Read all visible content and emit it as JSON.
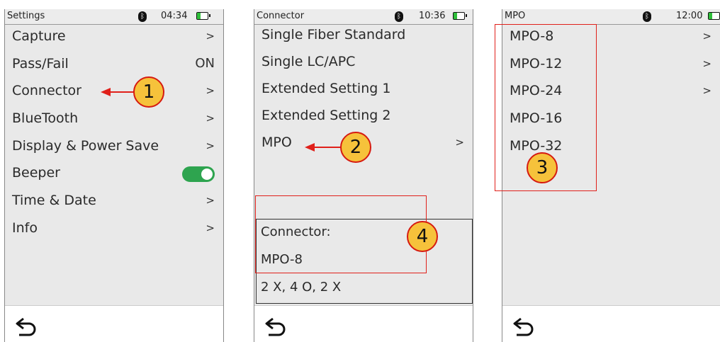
{
  "screens": [
    {
      "status": {
        "title": "Settings",
        "bt_icon": "bluetooth-icon",
        "time": "04:34"
      },
      "items": [
        {
          "label": "Capture",
          "value": ">"
        },
        {
          "label": "Pass/Fail",
          "value": "ON"
        },
        {
          "label": "Connector",
          "value": ">"
        },
        {
          "label": "BlueTooth",
          "value": ">"
        },
        {
          "label": "Display & Power Save",
          "value": ">"
        },
        {
          "label": "Beeper",
          "value": ""
        },
        {
          "label": "Time & Date",
          "value": ">"
        },
        {
          "label": "Info",
          "value": ">"
        }
      ],
      "beeper_on": true
    },
    {
      "status": {
        "title": "Connector",
        "time": "10:36"
      },
      "items": [
        {
          "label": "Single Fiber Standard",
          "value": ""
        },
        {
          "label": "Single LC/APC",
          "value": ""
        },
        {
          "label": "Extended Setting 1",
          "value": ""
        },
        {
          "label": "Extended Setting 2",
          "value": ""
        },
        {
          "label": "MPO",
          "value": ">"
        }
      ],
      "info": {
        "heading": "Connector:",
        "value": "MPO-8",
        "pattern": "2 X, 4 O, 2 X"
      }
    },
    {
      "status": {
        "title": "MPO",
        "time": "12:00"
      },
      "items": [
        {
          "label": "MPO-8",
          "value": ">"
        },
        {
          "label": "MPO-12",
          "value": ">"
        },
        {
          "label": "MPO-24",
          "value": ">"
        },
        {
          "label": "MPO-16",
          "value": ""
        },
        {
          "label": "MPO-32",
          "value": ""
        }
      ]
    }
  ],
  "callouts": [
    "1",
    "2",
    "3",
    "4"
  ],
  "colors": {
    "accent_red": "#e0201a",
    "callout_fill": "#f6c23b",
    "toggle_on": "#2ea44f",
    "battery": "#2fbf3a"
  }
}
